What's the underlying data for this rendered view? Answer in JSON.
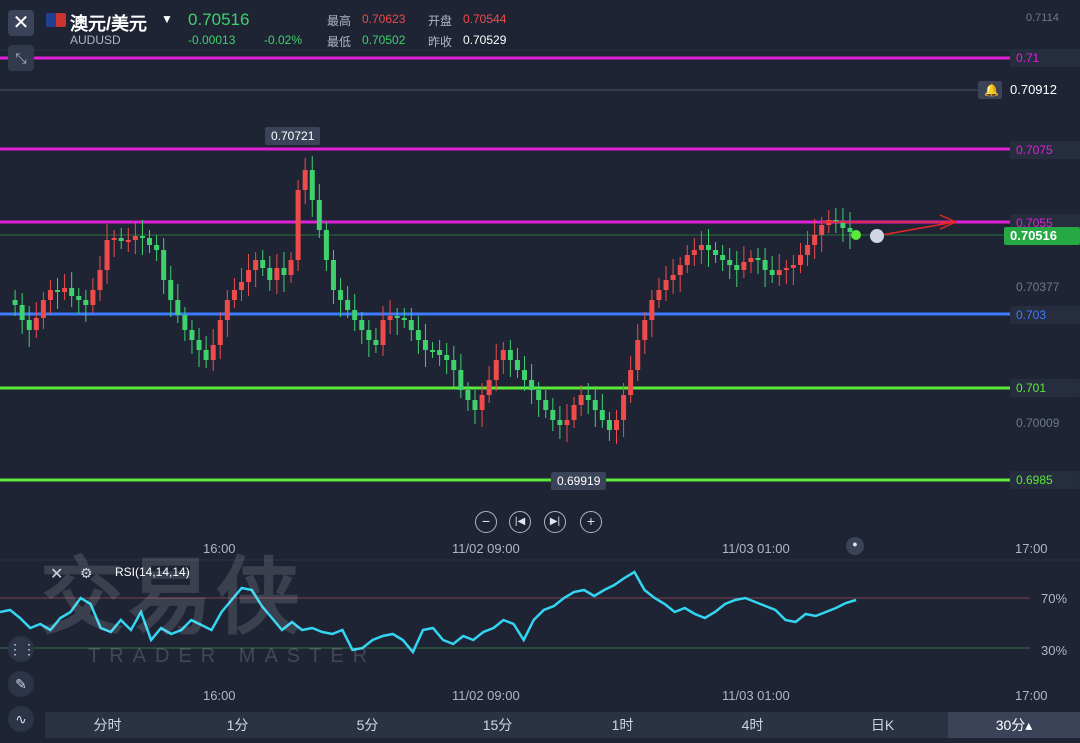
{
  "header": {
    "symbol_name": "澳元/美元",
    "symbol_code": "AUDUSD",
    "last_price": "0.70516",
    "change_abs": "-0.00013",
    "change_pct": "-0.02%",
    "high_label": "最高",
    "high_value": "0.70623",
    "open_label": "开盘",
    "open_value": "0.70544",
    "low_label": "最低",
    "low_value": "0.70502",
    "prevclose_label": "昨收",
    "prevclose_value": "0.70529"
  },
  "levels": [
    {
      "label": "0.71",
      "color": "#e020d8"
    },
    {
      "label": "0.7075",
      "color": "#e020d8"
    },
    {
      "label": "0.7055",
      "color": "#e020d8"
    },
    {
      "label": "0.703",
      "color": "#3d7cff"
    },
    {
      "label": "0.701",
      "color": "#5bea3a"
    },
    {
      "label": "0.6985",
      "color": "#5bea3a"
    }
  ],
  "axis_prices": {
    "top": "0.7114",
    "alert": "0.70912",
    "current": "0.70516",
    "p1": "0.70377",
    "p2": "0.70009"
  },
  "annotations": {
    "high_marker": "0.70721",
    "low_marker": "0.69919"
  },
  "time_axis": [
    "16:00",
    "11/02 09:00",
    "11/03 01:00",
    "17:00"
  ],
  "rsi": {
    "label": "RSI(14,14,14)",
    "upper": "70%",
    "lower": "30%"
  },
  "watermark": {
    "cn": "交易侠",
    "en": "TRADER MASTER"
  },
  "tabs": [
    "分时",
    "1分",
    "5分",
    "15分",
    "1时",
    "4时",
    "日K",
    "30分▴"
  ],
  "colors": {
    "up": "#ef4b4b",
    "down": "#3fd16c",
    "rsi": "#33d6f2"
  }
}
